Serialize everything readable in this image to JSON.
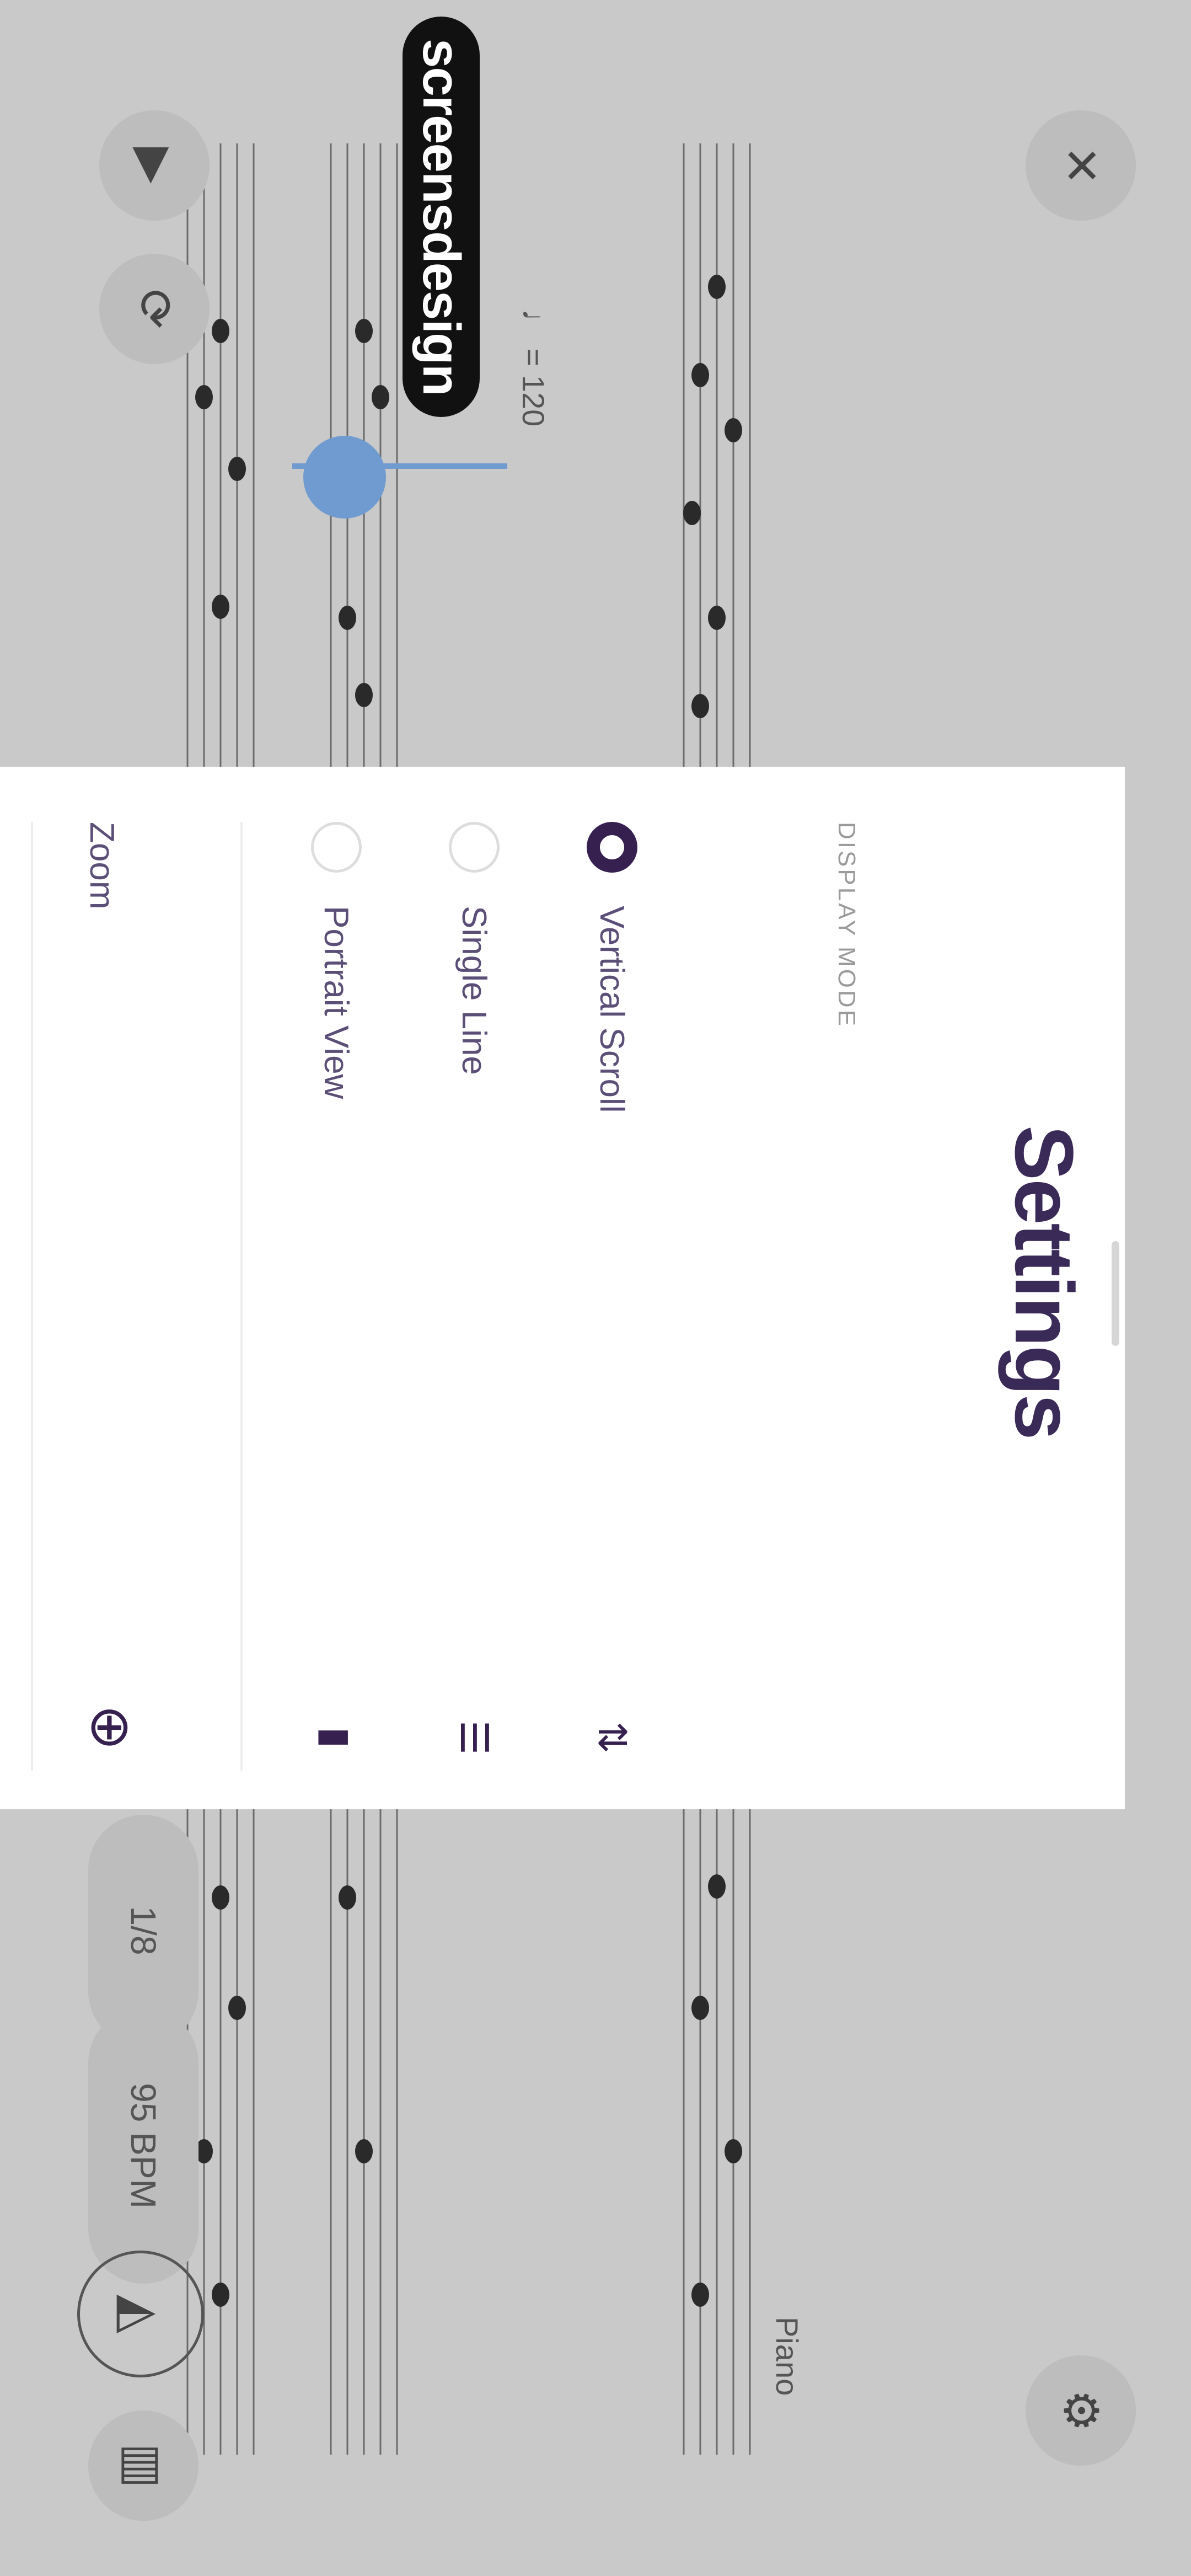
{
  "brand": {
    "logo_text": "screensdesign"
  },
  "toolbar": {
    "play_icon": "play-icon",
    "loop_icon": "loop-icon",
    "close_icon": "close-icon",
    "gear_icon": "gear-icon",
    "key_chip_label": "1/8",
    "tempo_chip_label": "95 BPM",
    "metronome_icon": "metronome-icon",
    "piano_icon": "piano-icon"
  },
  "score": {
    "tempo_mark": "♩ = 120",
    "part_name": "Piano"
  },
  "settings": {
    "title": "Settings",
    "section_label": "DISPLAY MODE",
    "options": [
      {
        "label": "Vertical Scroll",
        "selected": true,
        "icon": "vertical-scroll-icon"
      },
      {
        "label": "Single Line",
        "selected": false,
        "icon": "single-line-icon"
      },
      {
        "label": "Portrait View",
        "selected": false,
        "icon": "portrait-view-icon"
      }
    ],
    "zoom_label": "Zoom",
    "zoom_icon": "zoom-in-icon"
  },
  "colors": {
    "accent": "#35204f",
    "playhead": "#6f9bd0",
    "backdrop": "#c9c9c9"
  }
}
